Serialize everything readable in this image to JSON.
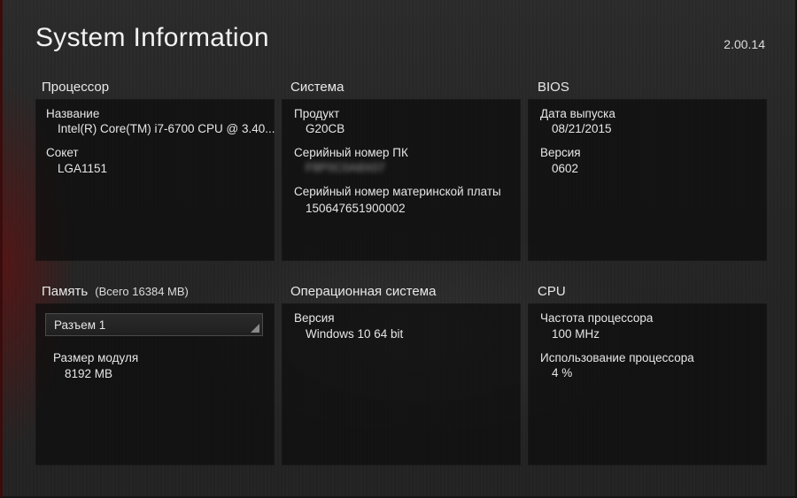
{
  "header": {
    "title": "System Information",
    "version": "2.00.14"
  },
  "processor": {
    "title": "Процессор",
    "name_label": "Название",
    "name_value": "Intel(R) Core(TM) i7-6700 CPU @ 3.40...",
    "socket_label": "Сокет",
    "socket_value": "LGA1151"
  },
  "system": {
    "title": "Система",
    "product_label": "Продукт",
    "product_value": "G20CB",
    "pc_serial_label": "Серийный номер ПК",
    "pc_serial_value": "F8P0C0A8X07",
    "mb_serial_label": "Серийный номер материнской платы",
    "mb_serial_value": "150647651900002"
  },
  "bios": {
    "title": "BIOS",
    "release_date_label": "Дата выпуска",
    "release_date_value": "08/21/2015",
    "version_label": "Версия",
    "version_value": "0602"
  },
  "memory": {
    "title": "Память",
    "total": "(Всего 16384 MB)",
    "slot_selected": "Разъем 1",
    "module_size_label": "Размер модуля",
    "module_size_value": "8192 MB"
  },
  "os": {
    "title": "Операционная система",
    "version_label": "Версия",
    "version_value": "Windows 10 64 bit"
  },
  "cpu": {
    "title": "CPU",
    "frequency_label": "Частота процессора",
    "frequency_value": "100 MHz",
    "usage_label": "Использование процессора",
    "usage_value": "4 %"
  }
}
